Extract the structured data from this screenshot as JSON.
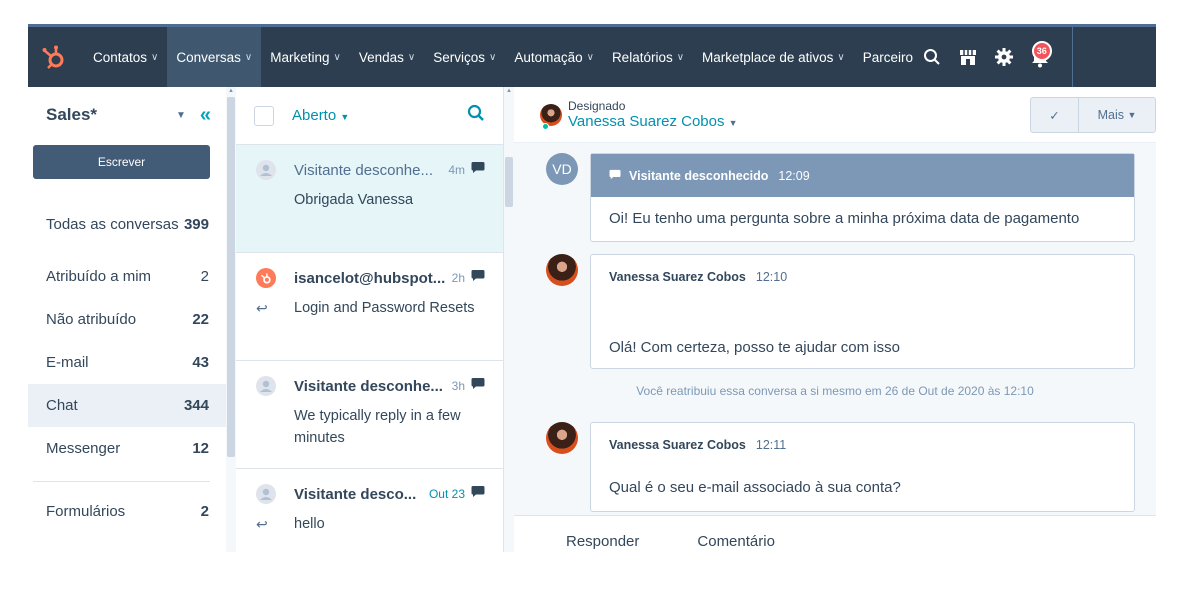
{
  "nav": {
    "items": [
      {
        "label": "Contatos",
        "active": false
      },
      {
        "label": "Conversas",
        "active": true
      },
      {
        "label": "Marketing",
        "active": false
      },
      {
        "label": "Vendas",
        "active": false
      },
      {
        "label": "Serviços",
        "active": false
      },
      {
        "label": "Automação",
        "active": false
      },
      {
        "label": "Relatórios",
        "active": false
      },
      {
        "label": "Marketplace de ativos",
        "active": false
      },
      {
        "label": "Parceiro",
        "active": false
      }
    ],
    "notifications_count": "36",
    "colors": {
      "bar": "#2d3e50",
      "logo": "#ff7a59",
      "badge": "#f2545b"
    }
  },
  "sidebar": {
    "title": "Sales*",
    "compose_label": "Escrever",
    "items": [
      {
        "label": "Todas as conversas",
        "count": "399"
      },
      {
        "label": "Atribuído a mim",
        "count": "2"
      },
      {
        "label": "Não atribuído",
        "count": "22"
      },
      {
        "label": "E-mail",
        "count": "43"
      },
      {
        "label": "Chat",
        "count": "344",
        "active": true
      },
      {
        "label": "Messenger",
        "count": "12"
      }
    ],
    "forms": {
      "label": "Formulários",
      "count": "2"
    }
  },
  "list": {
    "filter_label": "Aberto",
    "conversations": [
      {
        "name": "Visitante desconhe...",
        "time": "4m",
        "message": "Obrigada Vanessa",
        "active": true,
        "unread": false
      },
      {
        "name": "isancelot@hubspot...",
        "time": "2h",
        "message": "Login and Password Resets",
        "active": false,
        "unread": true
      },
      {
        "name": "Visitante desconhe...",
        "time": "3h",
        "message": "We typically reply in a few minutes",
        "active": false,
        "unread": true
      },
      {
        "name": "Visitante desco...",
        "time": "Out 23",
        "message": "hello",
        "active": false,
        "unread": true
      }
    ]
  },
  "thread": {
    "assigned_label": "Designado",
    "assignee": "Vanessa Suarez Cobos",
    "more_label": "Mais",
    "messages": [
      {
        "initials": "VD",
        "sender": "Visitante desconhecido",
        "time": "12:09",
        "text": "Oi! Eu tenho uma pergunta sobre a minha próxima data de pagamento"
      },
      {
        "sender": "Vanessa Suarez Cobos",
        "time": "12:10",
        "text": "Olá! Com certeza, posso te ajudar com isso"
      },
      {
        "sender": "Vanessa Suarez Cobos",
        "time": "12:11",
        "text": "Qual é o seu e-mail associado à sua conta?"
      }
    ],
    "event_text": "Você reatribuiu essa conversa a si mesmo em 26 de Out de 2020 às 12:10",
    "tabs": {
      "reply": "Responder",
      "comment": "Comentário"
    }
  }
}
